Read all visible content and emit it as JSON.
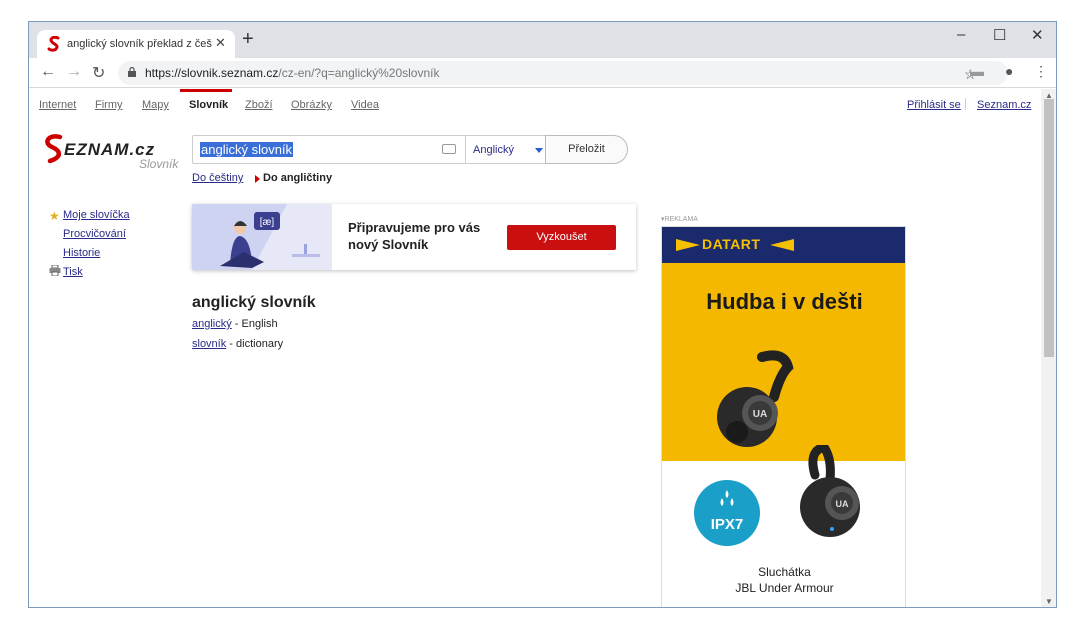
{
  "browser": {
    "tab_title": "anglický slovník překlad z češtiny",
    "tab_close": "✕",
    "new_tab": "+",
    "url_host": "https://slovnik.seznam.cz",
    "url_rest": "/cz-en/?q=anglický%20slovník",
    "minimize": "–",
    "maximize": "☐",
    "close": "✕"
  },
  "topnav": {
    "items": [
      "Internet",
      "Firmy",
      "Mapy",
      "Slovník",
      "Zboží",
      "Obrázky",
      "Videa"
    ],
    "active": "Slovník",
    "login": "Přihlásit se",
    "home": "Seznam.cz"
  },
  "logo": {
    "text": "SEZNAM.CZ",
    "subtitle": "Slovník"
  },
  "search": {
    "query": "anglický slovník",
    "language": "Anglický",
    "translate_label": "Přeložit",
    "dir_inactive": "Do češtiny",
    "dir_active": "Do angličtiny"
  },
  "sidebar": {
    "items": [
      "Moje slovíčka",
      "Procvičování",
      "Historie",
      "Tisk"
    ]
  },
  "banner": {
    "bubble": "[æ]",
    "text": "Připravujeme pro vás nový Slovník",
    "button": "Vyzkoušet"
  },
  "result": {
    "title": "anglický slovník",
    "rows": [
      {
        "word": "anglický",
        "translation": " - English"
      },
      {
        "word": "slovník",
        "translation": " - dictionary"
      }
    ]
  },
  "ad": {
    "label": "▾REKLAMA",
    "brand": "DATART",
    "headline": "Hudba i v dešti",
    "badge": "IPX7",
    "product_line1": "Sluchátka",
    "product_line2": "JBL Under Armour"
  },
  "colors": {
    "seznam_red": "#cc0000",
    "link_blue": "#2a2a8a",
    "ad_yellow": "#f5b800",
    "ad_navy": "#1a2a6c",
    "selection_blue": "#3b6fd8"
  }
}
